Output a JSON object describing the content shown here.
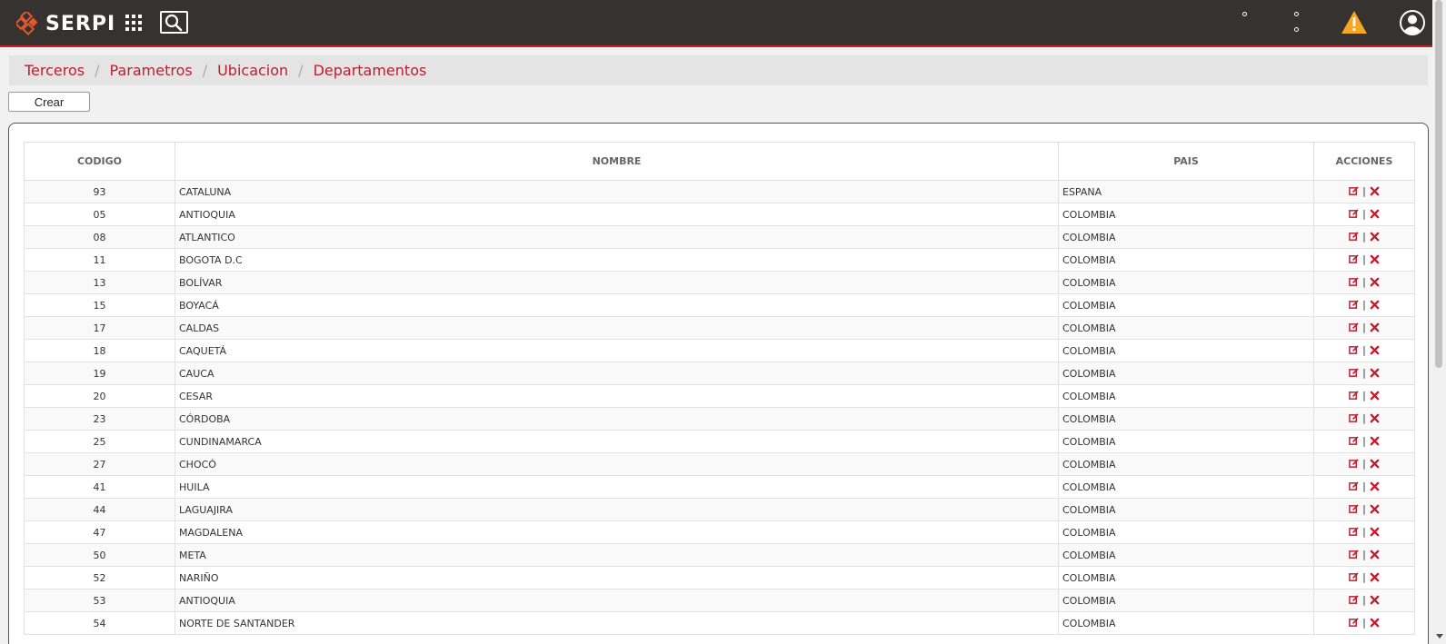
{
  "app": {
    "brand": "SERPI"
  },
  "colors": {
    "topbar": "#353230",
    "accent": "#c01d2e",
    "warning": "#f5a623"
  },
  "icons": {
    "logo": "serpi-diamond-logo-icon",
    "menu": "apps-grid-icon",
    "search": "search-icon",
    "warning": "warning-triangle-icon",
    "user": "user-circle-icon",
    "edit": "edit-icon",
    "delete": "close-icon"
  },
  "breadcrumb": [
    "Terceros",
    "Parametros",
    "Ubicacion",
    "Departamentos"
  ],
  "toolbar": {
    "create_label": "Crear"
  },
  "table": {
    "headers": {
      "codigo": "CODIGO",
      "nombre": "NOMBRE",
      "pais": "PAIS",
      "acciones": "ACCIONES"
    },
    "action_separator": "|",
    "rows": [
      {
        "codigo": "93",
        "nombre": "CATALUNA",
        "pais": "ESPANA"
      },
      {
        "codigo": "05",
        "nombre": "ANTIOQUIA",
        "pais": "COLOMBIA"
      },
      {
        "codigo": "08",
        "nombre": "ATLANTICO",
        "pais": "COLOMBIA"
      },
      {
        "codigo": "11",
        "nombre": "BOGOTA D.C",
        "pais": "COLOMBIA"
      },
      {
        "codigo": "13",
        "nombre": "BOLÍVAR",
        "pais": "COLOMBIA"
      },
      {
        "codigo": "15",
        "nombre": "BOYACÁ",
        "pais": "COLOMBIA"
      },
      {
        "codigo": "17",
        "nombre": "CALDAS",
        "pais": "COLOMBIA"
      },
      {
        "codigo": "18",
        "nombre": "CAQUETÁ",
        "pais": "COLOMBIA"
      },
      {
        "codigo": "19",
        "nombre": "CAUCA",
        "pais": "COLOMBIA"
      },
      {
        "codigo": "20",
        "nombre": "CESAR",
        "pais": "COLOMBIA"
      },
      {
        "codigo": "23",
        "nombre": "CÓRDOBA",
        "pais": "COLOMBIA"
      },
      {
        "codigo": "25",
        "nombre": "CUNDINAMARCA",
        "pais": "COLOMBIA"
      },
      {
        "codigo": "27",
        "nombre": "CHOCÓ",
        "pais": "COLOMBIA"
      },
      {
        "codigo": "41",
        "nombre": "HUILA",
        "pais": "COLOMBIA"
      },
      {
        "codigo": "44",
        "nombre": "LAGUAJIRA",
        "pais": "COLOMBIA"
      },
      {
        "codigo": "47",
        "nombre": "MAGDALENA",
        "pais": "COLOMBIA"
      },
      {
        "codigo": "50",
        "nombre": "META",
        "pais": "COLOMBIA"
      },
      {
        "codigo": "52",
        "nombre": "NARIÑO",
        "pais": "COLOMBIA"
      },
      {
        "codigo": "53",
        "nombre": "ANTIOQUIA",
        "pais": "COLOMBIA"
      },
      {
        "codigo": "54",
        "nombre": "NORTE DE SANTANDER",
        "pais": "COLOMBIA"
      }
    ]
  }
}
